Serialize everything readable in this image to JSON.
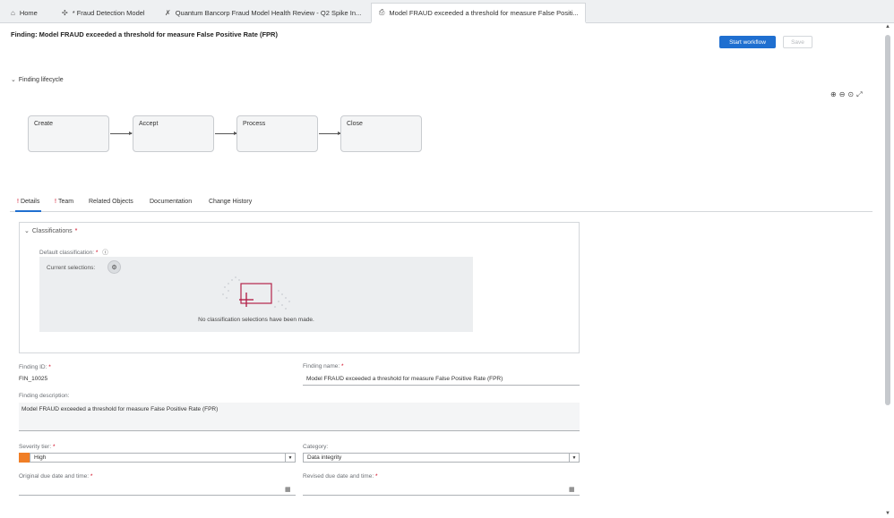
{
  "tabs": [
    {
      "label": "Home",
      "icon": "home-icon"
    },
    {
      "label": "* Fraud Detection Model",
      "icon": "model-icon"
    },
    {
      "label": "Quantum Bancorp Fraud Model Health Review - Q2 Spike In...",
      "icon": "review-icon"
    },
    {
      "label": "Model FRAUD exceeded a threshold for measure False Positi...",
      "icon": "finding-icon",
      "more": "⋮"
    }
  ],
  "page": {
    "title": "Finding: Model FRAUD exceeded a threshold for measure False Positive Rate (FPR)",
    "start_workflow": "Start workflow",
    "save": "Save"
  },
  "lifecycle": {
    "label": "Finding lifecycle",
    "stages": [
      "Create",
      "Accept",
      "Process",
      "Close"
    ]
  },
  "detail_tabs": [
    {
      "label": "Details",
      "required": "!"
    },
    {
      "label": "Team",
      "required": "!"
    },
    {
      "label": "Related Objects"
    },
    {
      "label": "Documentation"
    },
    {
      "label": "Change History"
    }
  ],
  "classifications": {
    "label": "Classifications",
    "default_label": "Default classification:",
    "current_label": "Current selections:",
    "empty_text": "No classification selections have been made.",
    "required_marker": "*"
  },
  "form": {
    "finding_id_label": "Finding ID:",
    "finding_id": "FIN_10025",
    "finding_name_label": "Finding name:",
    "finding_name": "Model FRAUD exceeded a threshold for measure False Positive Rate (FPR)",
    "description_label": "Finding description:",
    "description": "Model FRAUD exceeded a threshold for measure False Positive Rate (FPR)",
    "severity_label": "Severity tier:",
    "severity": "High",
    "category_label": "Category:",
    "category": "Data integrity",
    "orig_due_label": "Original due date and time:",
    "revised_due_label": "Revised due date and time:"
  },
  "colors": {
    "accent": "#1f6fd0",
    "severity_high": "#f07e26",
    "required": "#d0021b"
  }
}
